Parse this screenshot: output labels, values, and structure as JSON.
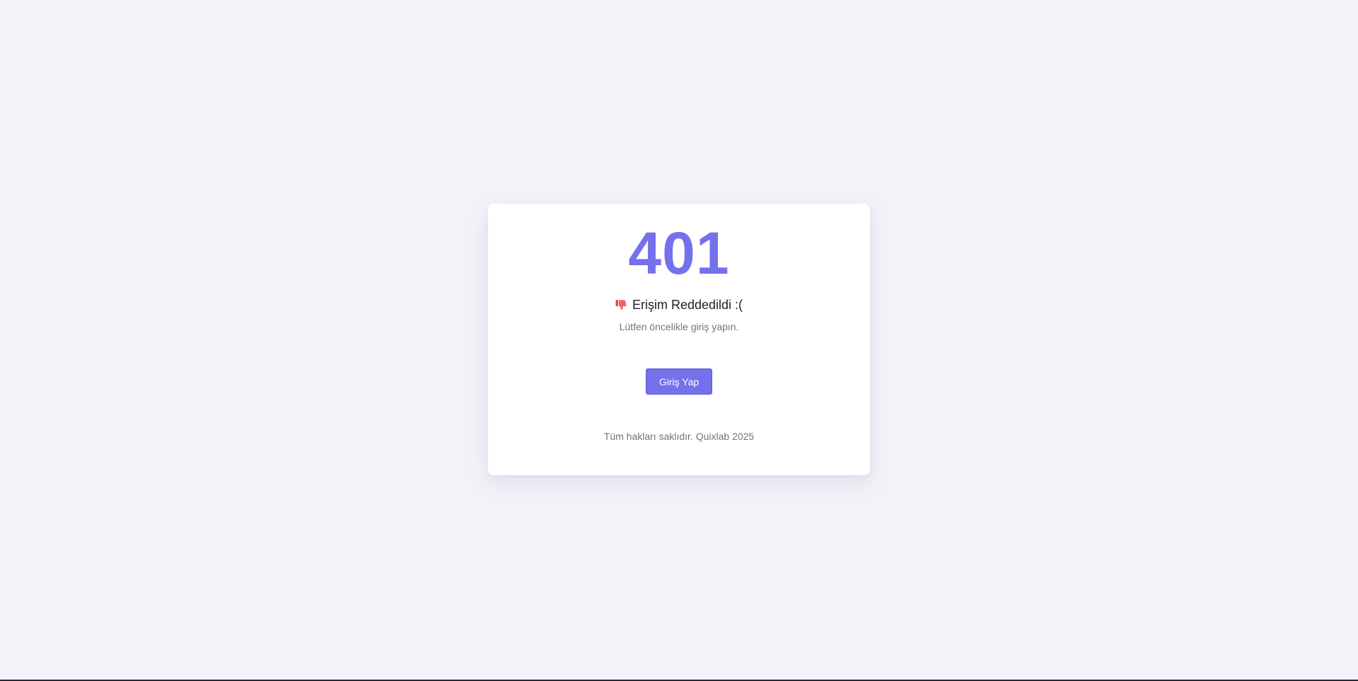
{
  "error": {
    "code": "401",
    "title": "Erişim Reddedildi :(",
    "title_icon": "thumbs-down-icon",
    "message": "Lütfen öncelikle giriş yapın.",
    "login_button_label": "Giriş Yap",
    "footer": "Tüm hakları saklıdır. Quixlab 2025"
  },
  "colors": {
    "background": "#f2f2f8",
    "accent": "#7570ec",
    "icon": "#ef5a5a",
    "muted_text": "#707483"
  }
}
